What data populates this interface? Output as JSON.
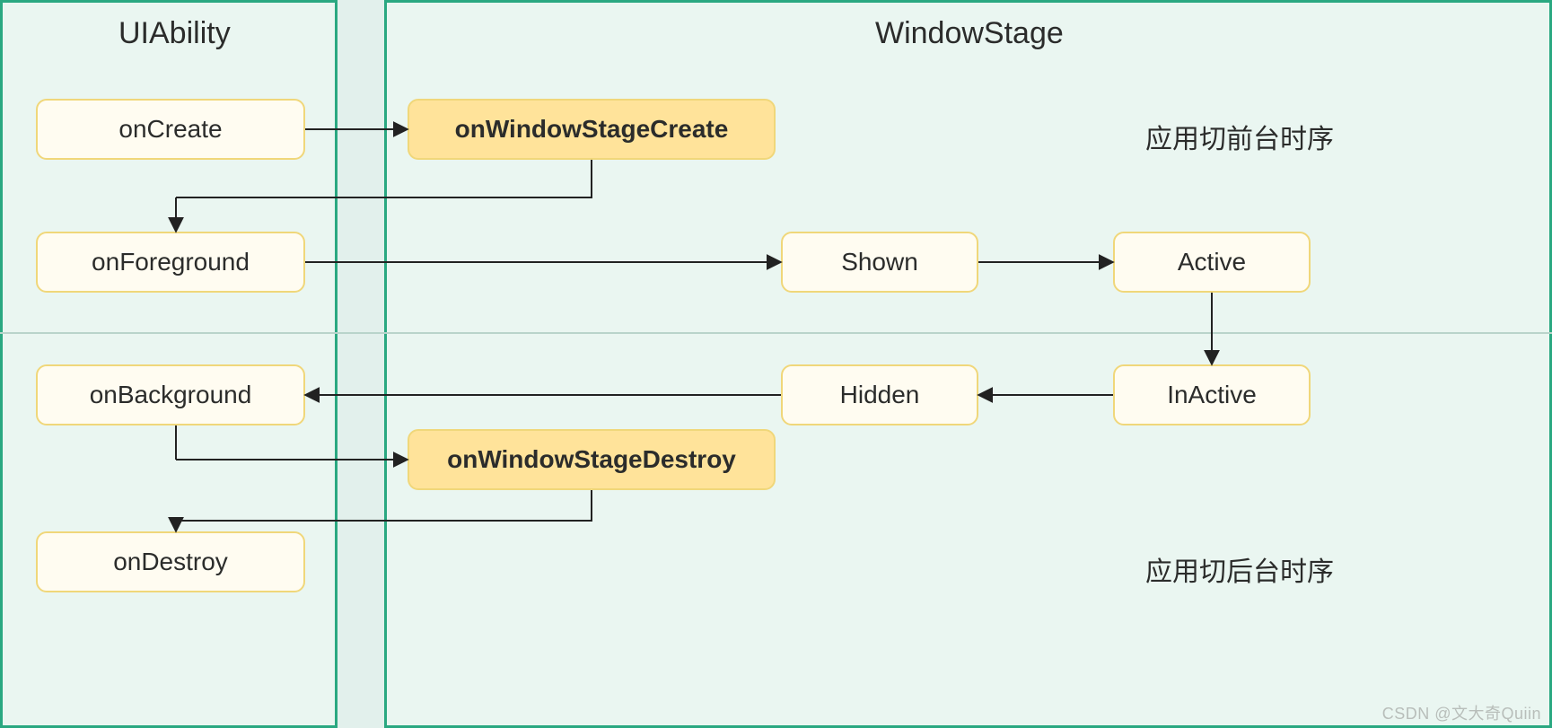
{
  "columns": {
    "left_title": "UIAbility",
    "right_title": "WindowStage"
  },
  "annotations": {
    "foreground": "应用切前台时序",
    "background": "应用切后台时序"
  },
  "watermark": "CSDN @文大奇Quiin",
  "nodes": {
    "onCreate": "onCreate",
    "onWindowStageCreate": "onWindowStageCreate",
    "onForeground": "onForeground",
    "shown": "Shown",
    "active": "Active",
    "onBackground": "onBackground",
    "hidden": "Hidden",
    "inactive": "InActive",
    "onWindowStageDestroy": "onWindowStageDestroy",
    "onDestroy": "onDestroy"
  }
}
